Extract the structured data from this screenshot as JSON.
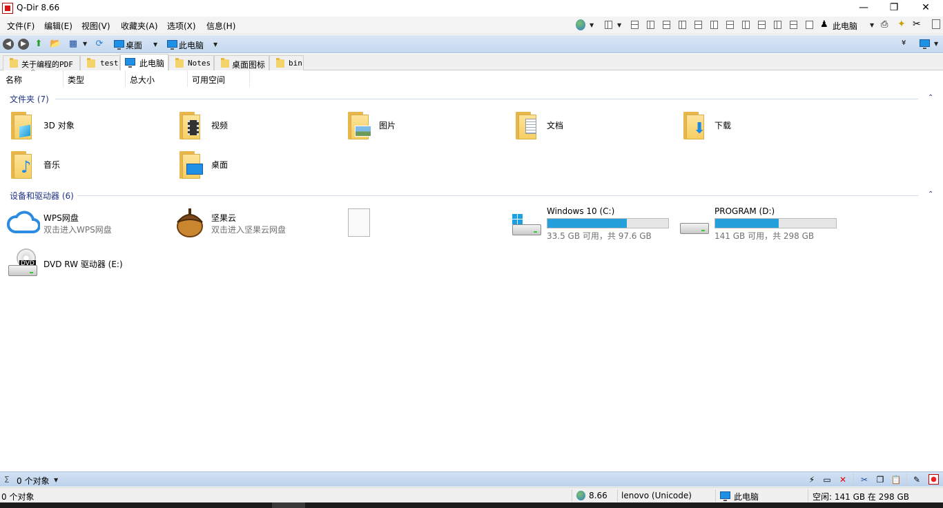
{
  "window": {
    "title": "Q-Dir 8.66",
    "minimize_glyph": "—",
    "maximize_glyph": "❐",
    "close_glyph": "✕"
  },
  "menu": {
    "items": [
      "文件(F)",
      "编辑(E)",
      "视图(V)",
      "收藏夹(A)",
      "选项(X)",
      "信息(H)"
    ],
    "computer_label": "此电脑"
  },
  "toolbar": {
    "desktop_label": "桌面",
    "computer_label": "此电脑"
  },
  "tabs": [
    {
      "label": "关于编程的PDF",
      "active": false
    },
    {
      "label": "test",
      "active": false
    },
    {
      "label": "此电脑",
      "active": true
    },
    {
      "label": "Notes",
      "active": false
    },
    {
      "label": "桌面图标",
      "active": false
    },
    {
      "label": "bin",
      "active": false
    }
  ],
  "columns": [
    "名称",
    "类型",
    "总大小",
    "可用空间"
  ],
  "groups": {
    "folders_header": "文件夹 (7)",
    "devices_header": "设备和驱动器 (6)"
  },
  "folders": [
    {
      "label": "3D 对象",
      "icon": "cube-icon"
    },
    {
      "label": "视频",
      "icon": "film-icon"
    },
    {
      "label": "图片",
      "icon": "picture-icon"
    },
    {
      "label": "文档",
      "icon": "document-icon"
    },
    {
      "label": "下载",
      "icon": "download-arrow-icon"
    },
    {
      "label": "音乐",
      "icon": "music-note-icon"
    },
    {
      "label": "桌面",
      "icon": "desktop-icon"
    }
  ],
  "devices": {
    "wps": {
      "name": "WPS网盘",
      "sub": "双击进入WPS网盘"
    },
    "jianguo": {
      "name": "坚果云",
      "sub": "双击进入坚果云网盘"
    },
    "drive_c": {
      "name": "Windows 10 (C:)",
      "sub": "33.5 GB 可用，共 97.6 GB",
      "used_fraction": 0.657
    },
    "drive_d": {
      "name": "PROGRAM (D:)",
      "sub": "141 GB 可用，共 298 GB",
      "used_fraction": 0.527
    },
    "dvd": {
      "name": "DVD RW 驱动器 (E:)",
      "badge": "DVD"
    }
  },
  "status_top": {
    "sigma": "Σ",
    "count": "0 个对象"
  },
  "status_bottom": {
    "count": "0 个对象",
    "version": "8.66",
    "user": "lenovo (Unicode)",
    "location": "此电脑",
    "free": "空闲: 141 GB 在 298 GB"
  },
  "colors": {
    "accent": "#26a0da",
    "group_text": "#1e3287",
    "folder": "#f6cf63"
  }
}
